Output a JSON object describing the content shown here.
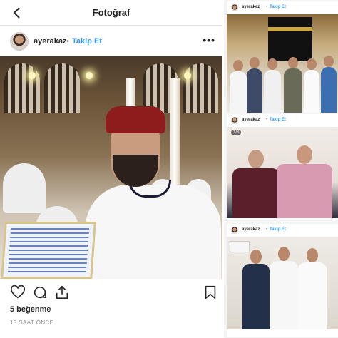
{
  "topbar": {
    "title": "Fotoğraf"
  },
  "post": {
    "username": "ayerakaz",
    "separator": "•",
    "follow_label": "Takip Et",
    "likes": "5 beğenme",
    "time": "13 SAAT ÖNCE"
  },
  "side_posts": [
    {
      "username": "ayerakaz",
      "separator": "•",
      "follow_label": "Takip Et"
    },
    {
      "username": "ayerakaz",
      "separator": "•",
      "follow_label": "Takip Et",
      "counter": "1/3"
    },
    {
      "username": "ayerakaz",
      "separator": "•",
      "follow_label": "Takip Et"
    }
  ],
  "icons": {
    "back": "chevron-left-icon",
    "more": "more-horizontal-icon",
    "like": "heart-icon",
    "comment": "comment-icon",
    "share": "share-icon",
    "save": "bookmark-icon"
  },
  "colors": {
    "link_blue": "#3897f0",
    "text": "#262626",
    "muted": "#8e8e8e"
  }
}
